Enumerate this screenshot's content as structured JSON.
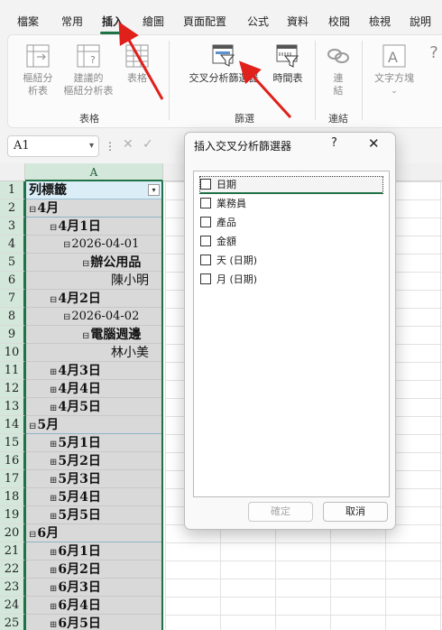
{
  "tabs": [
    "檔案",
    "常用",
    "插入",
    "繪圖",
    "頁面配置",
    "公式",
    "資料",
    "校閱",
    "檢視",
    "說明"
  ],
  "active_tab": "插入",
  "ribbon": {
    "pivot_table": "樞紐分\n析表",
    "recommended_pivot": "建議的\n樞紐分析表",
    "table": "表格",
    "group_tables": "表格",
    "slicer": "交叉分析篩選器",
    "timeline": "時間表",
    "group_filters": "篩選",
    "link": "連\n結",
    "group_links": "連結",
    "textbox": "文字方塊",
    "more": "?"
  },
  "formula_bar": {
    "name_box": "A1",
    "dots": "⋮",
    "cancel": "✕",
    "enter": "✓"
  },
  "sheet": {
    "col_a": "A",
    "rows": [
      "1",
      "2",
      "3",
      "4",
      "5",
      "6",
      "7",
      "8",
      "9",
      "10",
      "11",
      "12",
      "13",
      "14",
      "15",
      "16",
      "17",
      "18",
      "19",
      "20",
      "21",
      "22",
      "23",
      "24",
      "25"
    ],
    "cells": [
      {
        "text": "列標籤",
        "toggle": "",
        "level": 0
      },
      {
        "text": "4月",
        "toggle": "⊟",
        "level": 0
      },
      {
        "text": "4月1日",
        "toggle": "⊟",
        "level": 1
      },
      {
        "text": "2026-04-01",
        "toggle": "⊟",
        "level": 2
      },
      {
        "text": "辦公用品",
        "toggle": "⊟",
        "level": 3
      },
      {
        "text": "陳小明",
        "toggle": "",
        "level": 4
      },
      {
        "text": "4月2日",
        "toggle": "⊟",
        "level": 1
      },
      {
        "text": "2026-04-02",
        "toggle": "⊟",
        "level": 2
      },
      {
        "text": "電腦週邊",
        "toggle": "⊟",
        "level": 3
      },
      {
        "text": "林小美",
        "toggle": "",
        "level": 4
      },
      {
        "text": "4月3日",
        "toggle": "⊞",
        "level": 1
      },
      {
        "text": "4月4日",
        "toggle": "⊞",
        "level": 1
      },
      {
        "text": "4月5日",
        "toggle": "⊞",
        "level": 1
      },
      {
        "text": "5月",
        "toggle": "⊟",
        "level": 0
      },
      {
        "text": "5月1日",
        "toggle": "⊞",
        "level": 1
      },
      {
        "text": "5月2日",
        "toggle": "⊞",
        "level": 1
      },
      {
        "text": "5月3日",
        "toggle": "⊞",
        "level": 1
      },
      {
        "text": "5月4日",
        "toggle": "⊞",
        "level": 1
      },
      {
        "text": "5月5日",
        "toggle": "⊞",
        "level": 1
      },
      {
        "text": "6月",
        "toggle": "⊟",
        "level": 0
      },
      {
        "text": "6月1日",
        "toggle": "⊞",
        "level": 1
      },
      {
        "text": "6月2日",
        "toggle": "⊞",
        "level": 1
      },
      {
        "text": "6月3日",
        "toggle": "⊞",
        "level": 1
      },
      {
        "text": "6月4日",
        "toggle": "⊞",
        "level": 1
      },
      {
        "text": "6月5日",
        "toggle": "⊞",
        "level": 1
      }
    ]
  },
  "dialog": {
    "title": "插入交叉分析篩選器",
    "help": "?",
    "close": "✕",
    "options": [
      {
        "label": "日期",
        "checked": false
      },
      {
        "label": "業務員",
        "checked": false
      },
      {
        "label": "產品",
        "checked": false
      },
      {
        "label": "金額",
        "checked": false
      },
      {
        "label": "天 (日期)",
        "checked": false
      },
      {
        "label": "月 (日期)",
        "checked": false
      }
    ],
    "ok": "確定",
    "cancel": "取消"
  },
  "colors": {
    "accent": "#1f7245",
    "arrow": "#e0201b"
  }
}
